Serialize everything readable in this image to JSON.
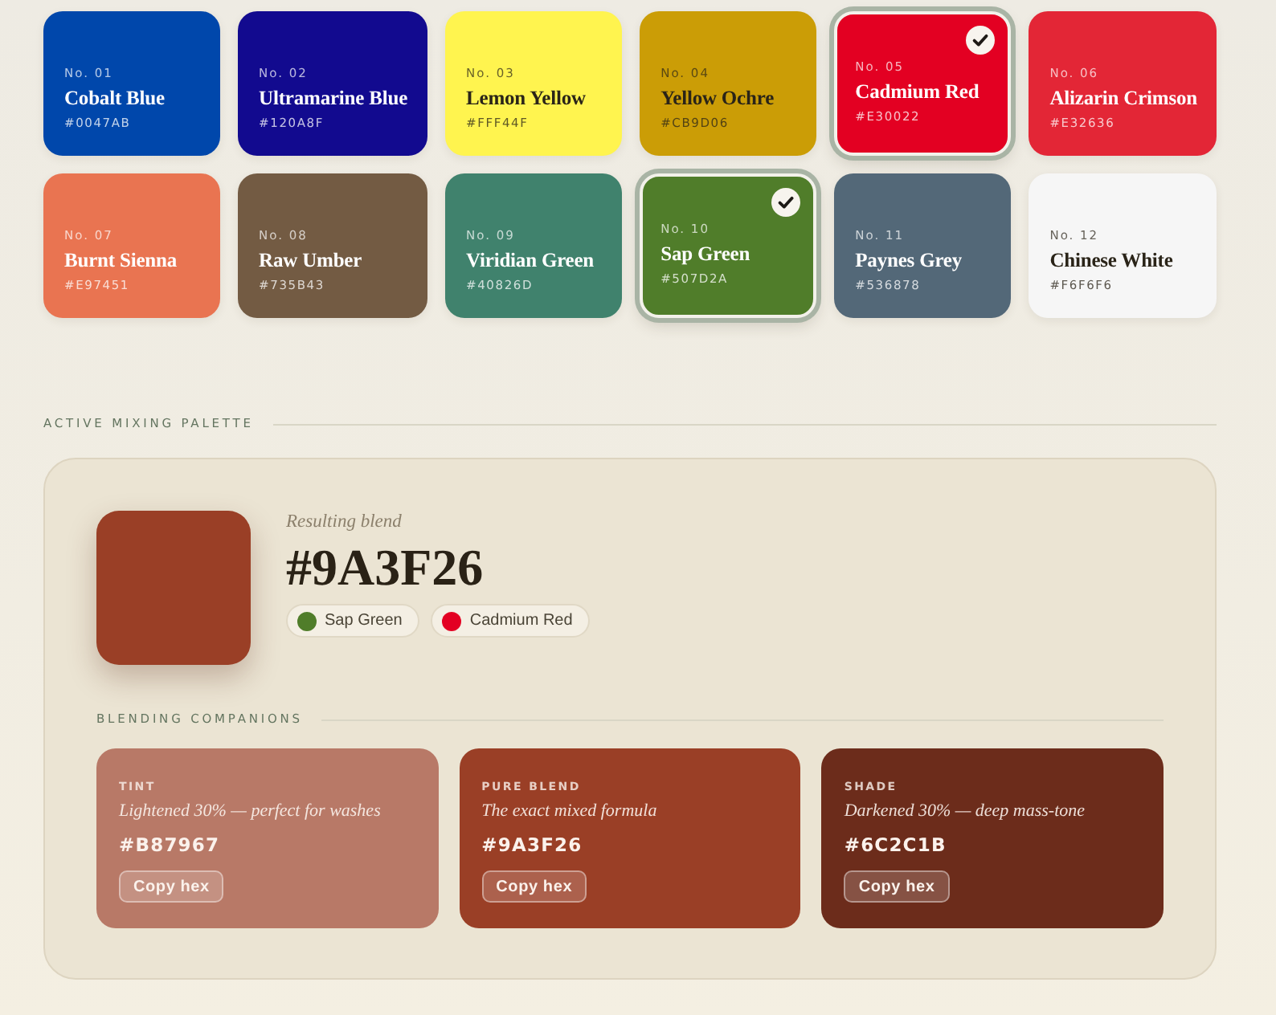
{
  "swatches": [
    {
      "number": "No. 01",
      "name": "Cobalt Blue",
      "hex": "#0047AB",
      "color": "#0047ab",
      "selected": false
    },
    {
      "number": "No. 02",
      "name": "Ultramarine Blue",
      "hex": "#120A8F",
      "color": "#120a8f",
      "selected": false
    },
    {
      "number": "No. 03",
      "name": "Lemon Yellow",
      "hex": "#FFF44F",
      "color": "#fff44f",
      "selected": false
    },
    {
      "number": "No. 04",
      "name": "Yellow Ochre",
      "hex": "#CB9D06",
      "color": "#cb9d06",
      "selected": false
    },
    {
      "number": "No. 05",
      "name": "Cadmium Red",
      "hex": "#E30022",
      "color": "#e30022",
      "selected": true
    },
    {
      "number": "No. 06",
      "name": "Alizarin Crimson",
      "hex": "#E32636",
      "color": "#e32636",
      "selected": false
    },
    {
      "number": "No. 07",
      "name": "Burnt Sienna",
      "hex": "#E97451",
      "color": "#e97451",
      "selected": false
    },
    {
      "number": "No. 08",
      "name": "Raw Umber",
      "hex": "#735B43",
      "color": "#735b43",
      "selected": false
    },
    {
      "number": "No. 09",
      "name": "Viridian Green",
      "hex": "#40826D",
      "color": "#40826d",
      "selected": false
    },
    {
      "number": "No. 10",
      "name": "Sap Green",
      "hex": "#507D2A",
      "color": "#507d2a",
      "selected": true
    },
    {
      "number": "No. 11",
      "name": "Paynes Grey",
      "hex": "#536878",
      "color": "#536878",
      "selected": false
    },
    {
      "number": "No. 12",
      "name": "Chinese White",
      "hex": "#F6F6F6",
      "color": "#f6f6f6",
      "selected": false
    }
  ],
  "mix": {
    "section_title": "ACTIVE MIXING PALETTE",
    "result": {
      "label": "Resulting blend",
      "hex": "#9A3F26",
      "color": "#9a3f26"
    },
    "ingredients": [
      {
        "name": "Sap Green",
        "color": "#507d2a"
      },
      {
        "name": "Cadmium Red",
        "color": "#e30022"
      }
    ],
    "companions_title": "BLENDING COMPANIONS",
    "companions": [
      {
        "label": "TINT",
        "description": "Lightened 30% — perfect for washes",
        "hex": "#B87967",
        "color": "#b87967",
        "button": "Copy hex"
      },
      {
        "label": "PURE BLEND",
        "description": "The exact mixed formula",
        "hex": "#9A3F26",
        "color": "#9a3f26",
        "button": "Copy hex"
      },
      {
        "label": "SHADE",
        "description": "Darkened 30% — deep mass-tone",
        "hex": "#6C2C1B",
        "color": "#6c2c1b",
        "button": "Copy hex"
      }
    ]
  }
}
